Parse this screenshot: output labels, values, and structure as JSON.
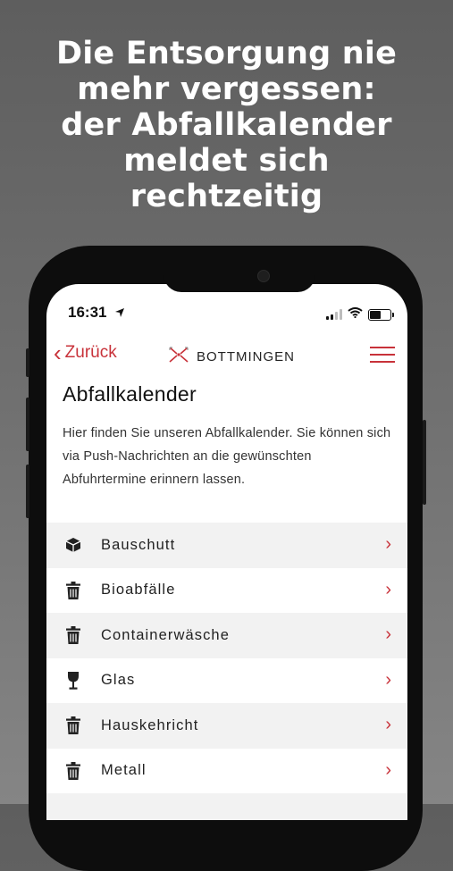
{
  "promo": {
    "headline": "Die Entsorgung nie\nmehr vergessen:\nder Abfallkalender\nmeldet sich\nrechtzeitig"
  },
  "status_bar": {
    "time": "16:31",
    "battery_level": 0.5
  },
  "nav": {
    "back_label": "Zurück",
    "brand": "BOTTMINGEN",
    "menu_icon": "hamburger-icon"
  },
  "page": {
    "title": "Abfallkalender",
    "intro": "Hier finden Sie unseren Abfallkalender. Sie können sich via Push-Nachrichten an die gewünschten Abfuhrtermine erinnern lassen."
  },
  "categories": [
    {
      "label": "Bauschutt",
      "icon": "box-icon"
    },
    {
      "label": "Bioabfälle",
      "icon": "trash-icon"
    },
    {
      "label": "Containerwäsche",
      "icon": "trash-icon"
    },
    {
      "label": "Glas",
      "icon": "wine-glass-icon"
    },
    {
      "label": "Hauskehricht",
      "icon": "trash-icon"
    },
    {
      "label": "Metall",
      "icon": "trash-icon"
    }
  ],
  "colors": {
    "accent": "#c8323a",
    "row_shade": "#f2f2f2"
  }
}
